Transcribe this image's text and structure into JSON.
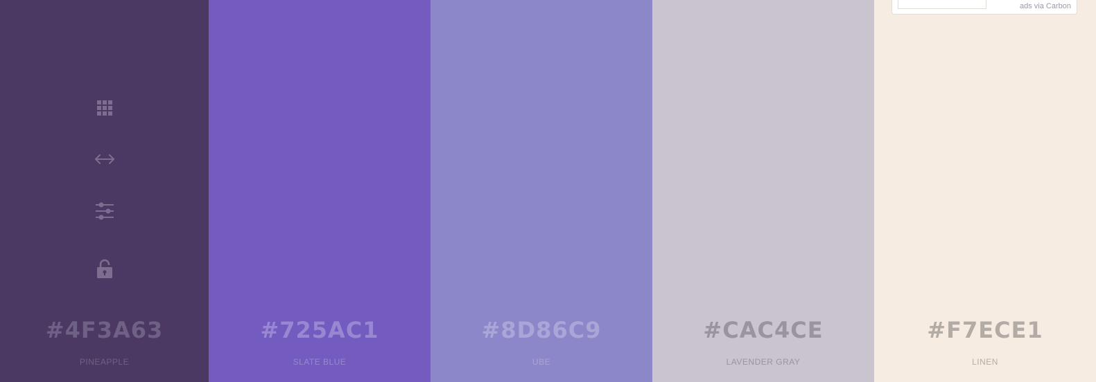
{
  "swatches": [
    {
      "hex": "#4F3A63",
      "name": "PINEAPPLE",
      "bg": "#4b3963",
      "text_color": "#6f6085"
    },
    {
      "hex": "#725AC1",
      "name": "SLATE BLUE",
      "bg": "#735bbf",
      "text_color": "#9987d1"
    },
    {
      "hex": "#8D86C9",
      "name": "UBE",
      "bg": "#8c87c8",
      "text_color": "#aaa6d8"
    },
    {
      "hex": "#CAC4CE",
      "name": "LAVENDER GRAY",
      "bg": "#cac4cf",
      "text_color": "#99949e"
    },
    {
      "hex": "#F7ECE1",
      "name": "LINEN",
      "bg": "#f6ece1",
      "text_color": "#b3aca6"
    }
  ],
  "tools": {
    "icon_color": "#7d6e90",
    "items": [
      {
        "icon": "grid-icon"
      },
      {
        "icon": "arrows-horizontal-icon"
      },
      {
        "icon": "sliders-icon"
      },
      {
        "icon": "lock-icon"
      }
    ]
  },
  "ad": {
    "label": "ads via Carbon"
  }
}
